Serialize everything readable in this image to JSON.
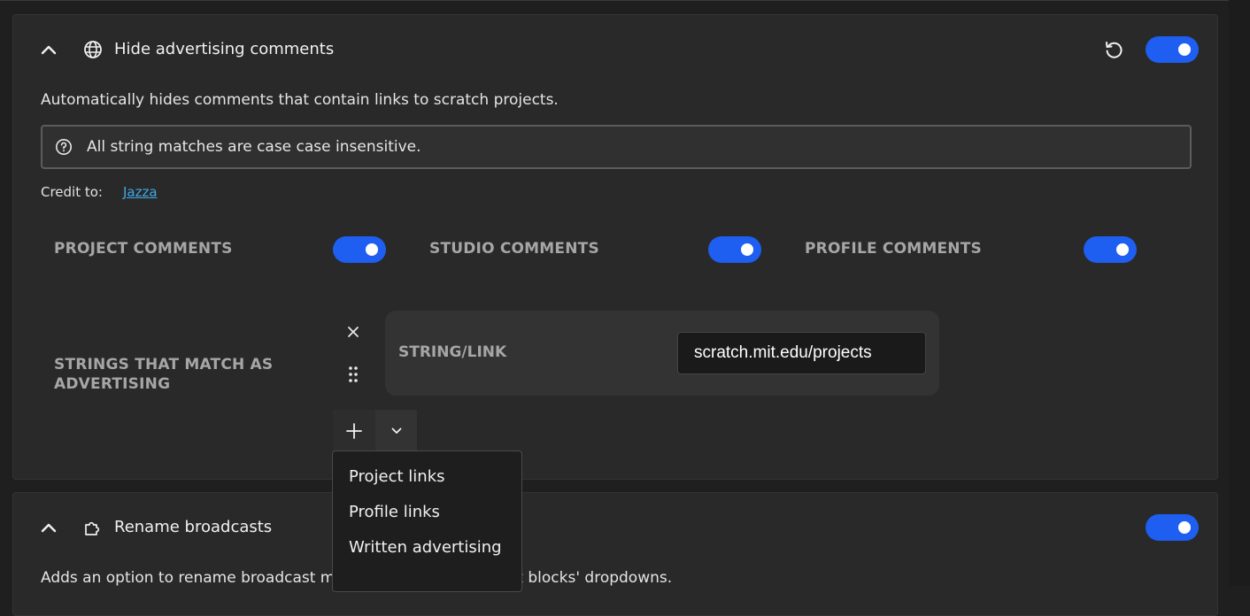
{
  "colors": {
    "accent": "#1e5ef0",
    "link": "#3fa9e8",
    "card_bg": "#292929",
    "page_bg": "#1f1f1f"
  },
  "addon1": {
    "title": "Hide advertising comments",
    "title_icon": "globe-icon",
    "enabled": true,
    "description": "Automatically hides comments that contain links to scratch projects.",
    "notice": "All string matches are case case insensitive.",
    "credit_label": "Credit to:",
    "credit_name": "Jazza",
    "settings": {
      "project_comments": {
        "label": "PROJECT COMMENTS",
        "enabled": true
      },
      "studio_comments": {
        "label": "STUDIO COMMENTS",
        "enabled": true
      },
      "profile_comments": {
        "label": "PROFILE COMMENTS",
        "enabled": true
      }
    },
    "strings_setting": {
      "label_line1": "STRINGS THAT MATCH AS",
      "label_line2": "ADVERTISING",
      "rows": [
        {
          "label": "STRING/LINK",
          "value": "scratch.mit.edu/projects"
        }
      ]
    },
    "preset_menu": {
      "items": [
        "Project links",
        "Profile links",
        "Written advertising"
      ]
    }
  },
  "addon2": {
    "title": "Rename broadcasts",
    "title_icon": "puzzle-piece-icon",
    "enabled": true,
    "description": "Adds an option to rename broadcast messages in the broadcast blocks' dropdowns."
  }
}
